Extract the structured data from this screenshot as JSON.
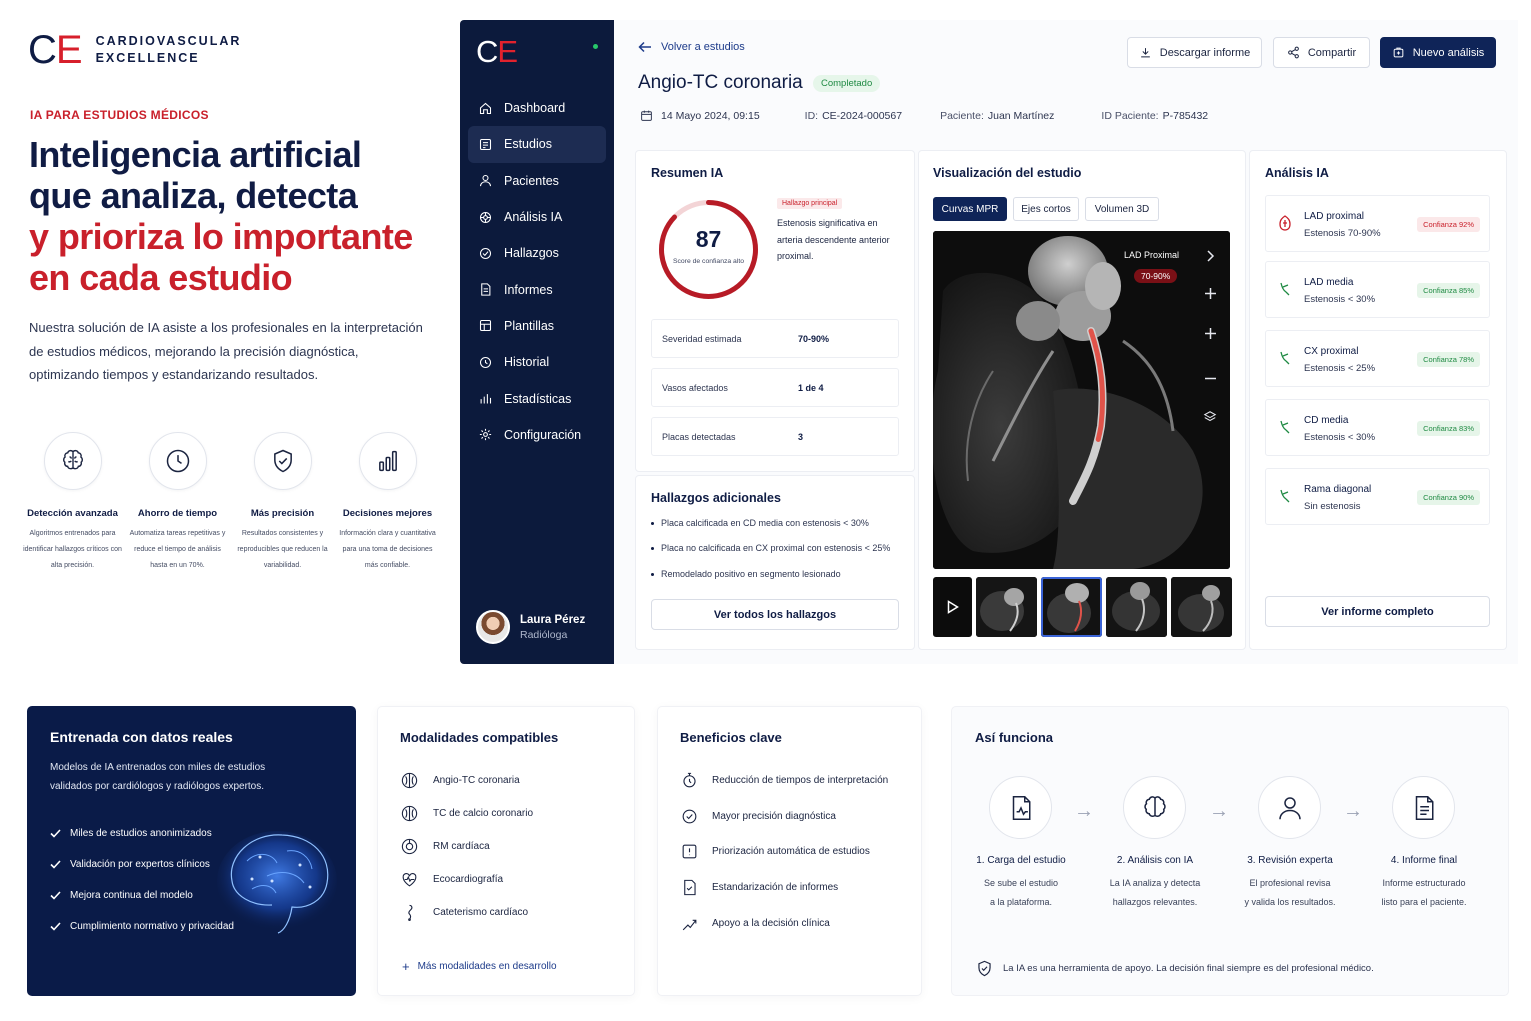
{
  "brand": {
    "mark_c": "C",
    "mark_e": "E",
    "line1": "CARDIOVASCULAR",
    "line2": "EXCELLENCE"
  },
  "hero": {
    "eyebrow": "IA PARA ESTUDIOS MÉDICOS",
    "title_l1": "Inteligencia artificial",
    "title_l2": "que analiza, detecta",
    "title_l3": "y prioriza lo importante",
    "title_l4": "en cada estudio",
    "description": "Nuestra solución de IA asiste a los profesionales en la interpretación de estudios médicos, mejorando la precisión diagnóstica, optimizando tiempos y estandarizando resultados."
  },
  "features": [
    {
      "icon": "brain-icon",
      "title": "Detección avanzada",
      "desc": "Algoritmos entrenados para identificar hallazgos críticos con alta precisión."
    },
    {
      "icon": "clock-icon",
      "title": "Ahorro de tiempo",
      "desc": "Automatiza tareas repetitivas y reduce el tiempo de análisis hasta en un 70%."
    },
    {
      "icon": "shield-icon",
      "title": "Más precisión",
      "desc": "Resultados consistentes y reproducibles que reducen la variabilidad."
    },
    {
      "icon": "bar-chart-icon",
      "title": "Decisiones mejores",
      "desc": "Información clara y cuantitativa para una toma de decisiones más confiable."
    }
  ],
  "sidebar": {
    "logo_c": "C",
    "logo_e": "E",
    "items": [
      {
        "label": "Dashboard",
        "icon": "home-icon"
      },
      {
        "label": "Estudios",
        "icon": "studies-icon",
        "active": true
      },
      {
        "label": "Pacientes",
        "icon": "patients-icon"
      },
      {
        "label": "Análisis IA",
        "icon": "ai-icon"
      },
      {
        "label": "Hallazgos",
        "icon": "findings-icon"
      },
      {
        "label": "Informes",
        "icon": "reports-icon"
      },
      {
        "label": "Plantillas",
        "icon": "templates-icon"
      },
      {
        "label": "Historial",
        "icon": "history-icon"
      },
      {
        "label": "Estadísticas",
        "icon": "stats-icon"
      },
      {
        "label": "Configuración",
        "icon": "settings-icon"
      }
    ],
    "user_name": "Laura Pérez",
    "user_role": "Radióloga"
  },
  "header": {
    "back": "Volver a estudios",
    "title": "Angio-TC coronaria",
    "status": "Completado",
    "date": "14 Mayo 2024, 09:15",
    "id_label": "ID:",
    "id_value": "CE-2024-000567",
    "patient_label": "Paciente:",
    "patient_value": "Juan Martínez",
    "pid_label": "ID Paciente:",
    "pid_value": "P-785432",
    "download": "Descargar informe",
    "share": "Compartir",
    "new": "Nuevo análisis"
  },
  "summary": {
    "title": "Resumen IA",
    "score": "87",
    "score_fraction": 0.87,
    "score_label": "Score de confianza alto",
    "badge": "Hallazgo principal",
    "finding": "Estenosis significativa en arteria descendente anterior proximal.",
    "rows": [
      {
        "k": "Severidad estimada",
        "v": "70-90%"
      },
      {
        "k": "Vasos afectados",
        "v": "1 de 4"
      },
      {
        "k": "Placas detectadas",
        "v": "3"
      }
    ]
  },
  "extra": {
    "title": "Hallazgos adicionales",
    "items": [
      "Placa calcificada en CD media con estenosis < 30%",
      "Placa no calcificada en CX proximal con estenosis < 25%",
      "Remodelado positivo en segmento lesionado"
    ],
    "button": "Ver todos los hallazgos"
  },
  "viz": {
    "title": "Visualización del estudio",
    "tabs": [
      "Curvas MPR",
      "Ejes cortos",
      "Volumen 3D"
    ],
    "label": "LAD Proximal",
    "pct": "70-90%"
  },
  "analysis": {
    "title": "Análisis IA",
    "items": [
      {
        "name": "LAD proximal",
        "desc": "Estenosis 70-90%",
        "conf": "Confianza 92%",
        "level": "red"
      },
      {
        "name": "LAD media",
        "desc": "Estenosis < 30%",
        "conf": "Confianza 85%",
        "level": "green"
      },
      {
        "name": "CX proximal",
        "desc": "Estenosis < 25%",
        "conf": "Confianza 78%",
        "level": "green"
      },
      {
        "name": "CD media",
        "desc": "Estenosis < 30%",
        "conf": "Confianza 83%",
        "level": "green"
      },
      {
        "name": "Rama diagonal",
        "desc": "Sin estenosis",
        "conf": "Confianza 90%",
        "level": "green"
      }
    ],
    "button": "Ver informe completo"
  },
  "trained": {
    "title": "Entrenada con datos reales",
    "desc": "Modelos de IA entrenados con miles de estudios validados por cardiólogos y radiólogos expertos.",
    "items": [
      "Miles de estudios anonimizados",
      "Validación por expertos clínicos",
      "Mejora continua del modelo",
      "Cumplimiento normativo y privacidad"
    ]
  },
  "modalities": {
    "title": "Modalidades compatibles",
    "items": [
      "Angio-TC coronaria",
      "TC de calcio coronario",
      "RM cardíaca",
      "Ecocardiografía",
      "Cateterismo cardíaco"
    ],
    "more": "Más modalidades en desarrollo"
  },
  "benefits": {
    "title": "Beneficios clave",
    "items": [
      "Reducción de tiempos de interpretación",
      "Mayor precisión diagnóstica",
      "Priorización automática de estudios",
      "Estandarización de informes",
      "Apoyo a la decisión clínica"
    ]
  },
  "how": {
    "title": "Así funciona",
    "steps": [
      {
        "title": "1. Carga del estudio",
        "l1": "Se sube el estudio",
        "l2": "a la plataforma."
      },
      {
        "title": "2. Análisis con IA",
        "l1": "La IA analiza y detecta",
        "l2": "hallazgos relevantes."
      },
      {
        "title": "3. Revisión experta",
        "l1": "El profesional revisa",
        "l2": "y valida los resultados."
      },
      {
        "title": "4. Informe final",
        "l1": "Informe estructurado",
        "l2": "listo para el paciente."
      }
    ],
    "note": "La IA es una herramienta de apoyo. La decisión final siempre es del profesional médico."
  }
}
